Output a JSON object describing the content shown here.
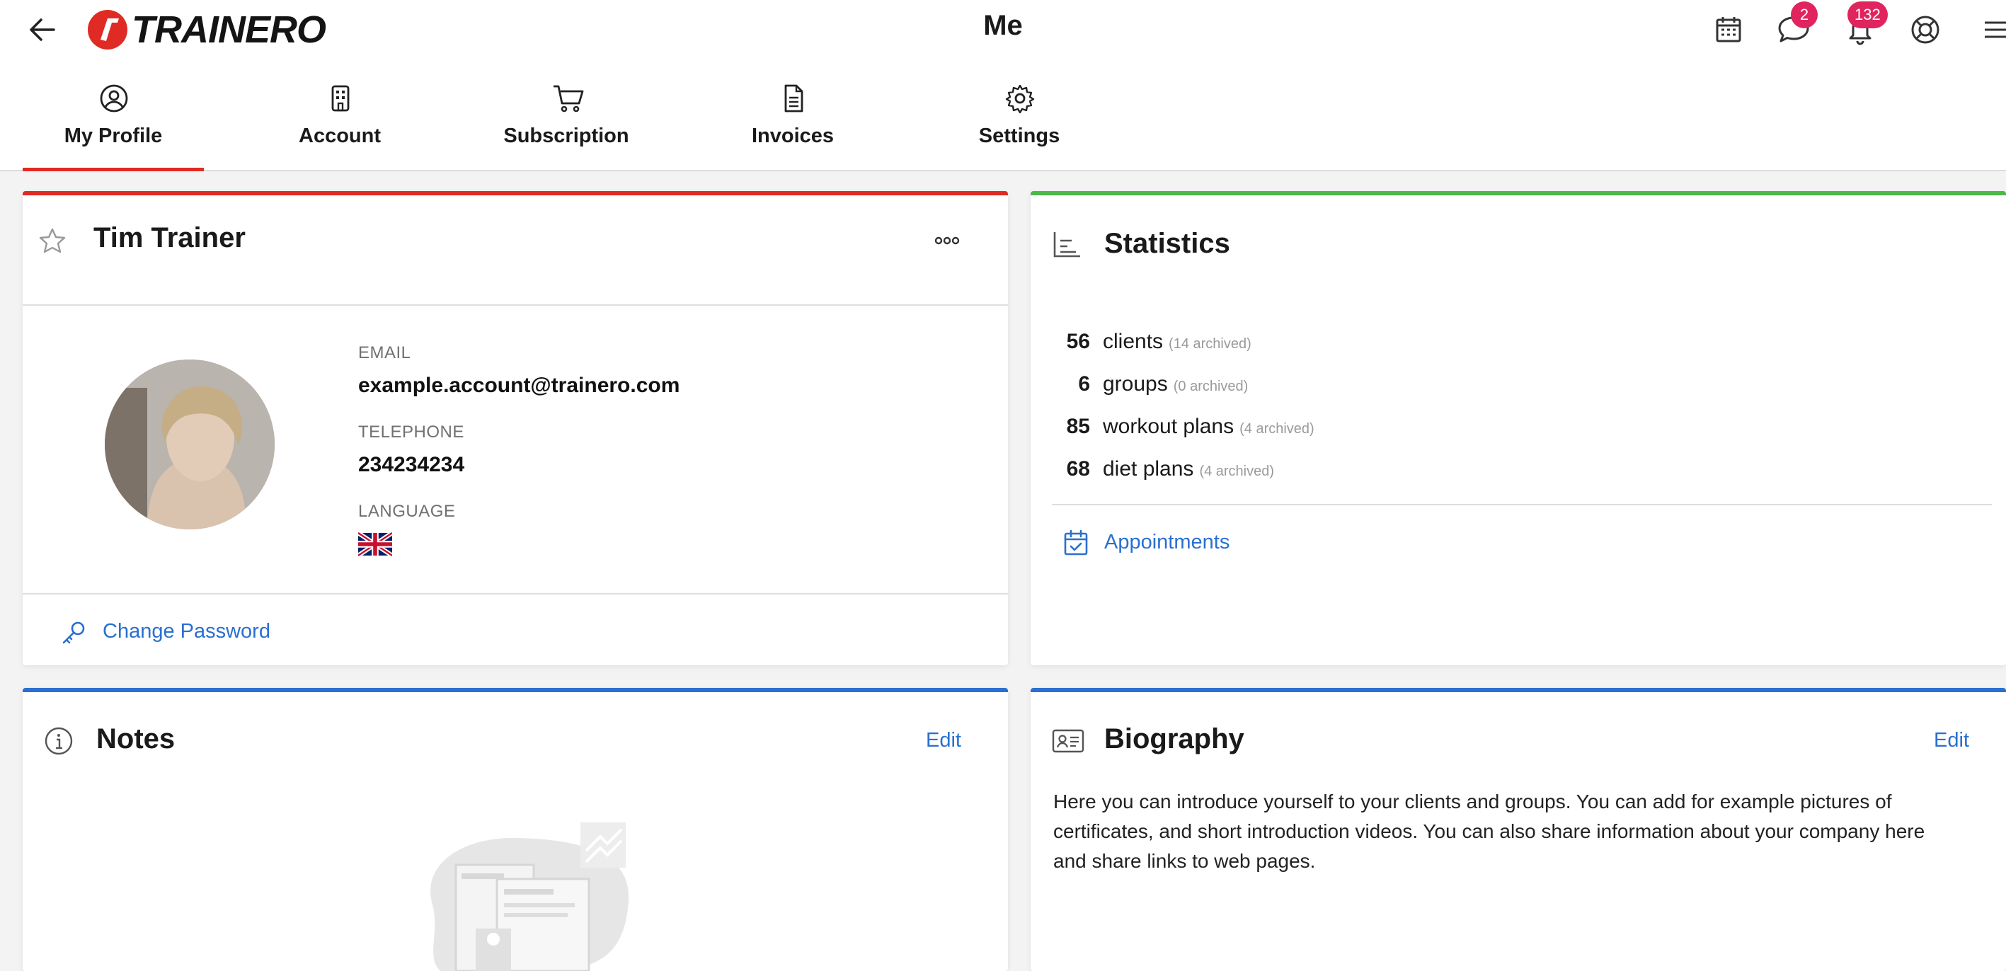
{
  "header": {
    "logo_text": "TRAINERO",
    "title": "Me",
    "icons": [
      "back-arrow-icon",
      "calendar-icon",
      "chat-icon",
      "bell-icon",
      "lifebuoy-icon",
      "menu-icon"
    ],
    "chat_badge": "2",
    "bell_badge": "132"
  },
  "tabs": [
    {
      "label": "My Profile",
      "icon": "user-circle-icon",
      "active": true
    },
    {
      "label": "Account",
      "icon": "building-icon"
    },
    {
      "label": "Subscription",
      "icon": "cart-icon"
    },
    {
      "label": "Invoices",
      "icon": "document-icon"
    },
    {
      "label": "Settings",
      "icon": "gear-icon"
    }
  ],
  "profile": {
    "name": "Tim Trainer",
    "email_label": "EMAIL",
    "email": "example.account@trainero.com",
    "phone_label": "TELEPHONE",
    "phone": "234234234",
    "language_label": "LANGUAGE",
    "change_password": "Change Password"
  },
  "statistics": {
    "title": "Statistics",
    "rows": [
      {
        "num": "56",
        "label": "clients",
        "archived": "(14 archived)"
      },
      {
        "num": "6",
        "label": "groups",
        "archived": "(0 archived)"
      },
      {
        "num": "85",
        "label": "workout plans",
        "archived": "(4 archived)"
      },
      {
        "num": "68",
        "label": "diet plans",
        "archived": "(4 archived)"
      }
    ],
    "appointments": "Appointments"
  },
  "notes": {
    "title": "Notes",
    "edit": "Edit"
  },
  "biography": {
    "title": "Biography",
    "edit": "Edit",
    "text": "Here you can introduce yourself to your clients and groups. You can add for example pictures of certificates, and short introduction videos. You can also share information about your company here and share links to web pages."
  },
  "colors": {
    "profile_accent": "#e02b24",
    "statistics_accent": "#4cb84a",
    "notes_accent": "#2a6fd1",
    "link": "#2a6fd1",
    "badge": "#e0245e"
  }
}
